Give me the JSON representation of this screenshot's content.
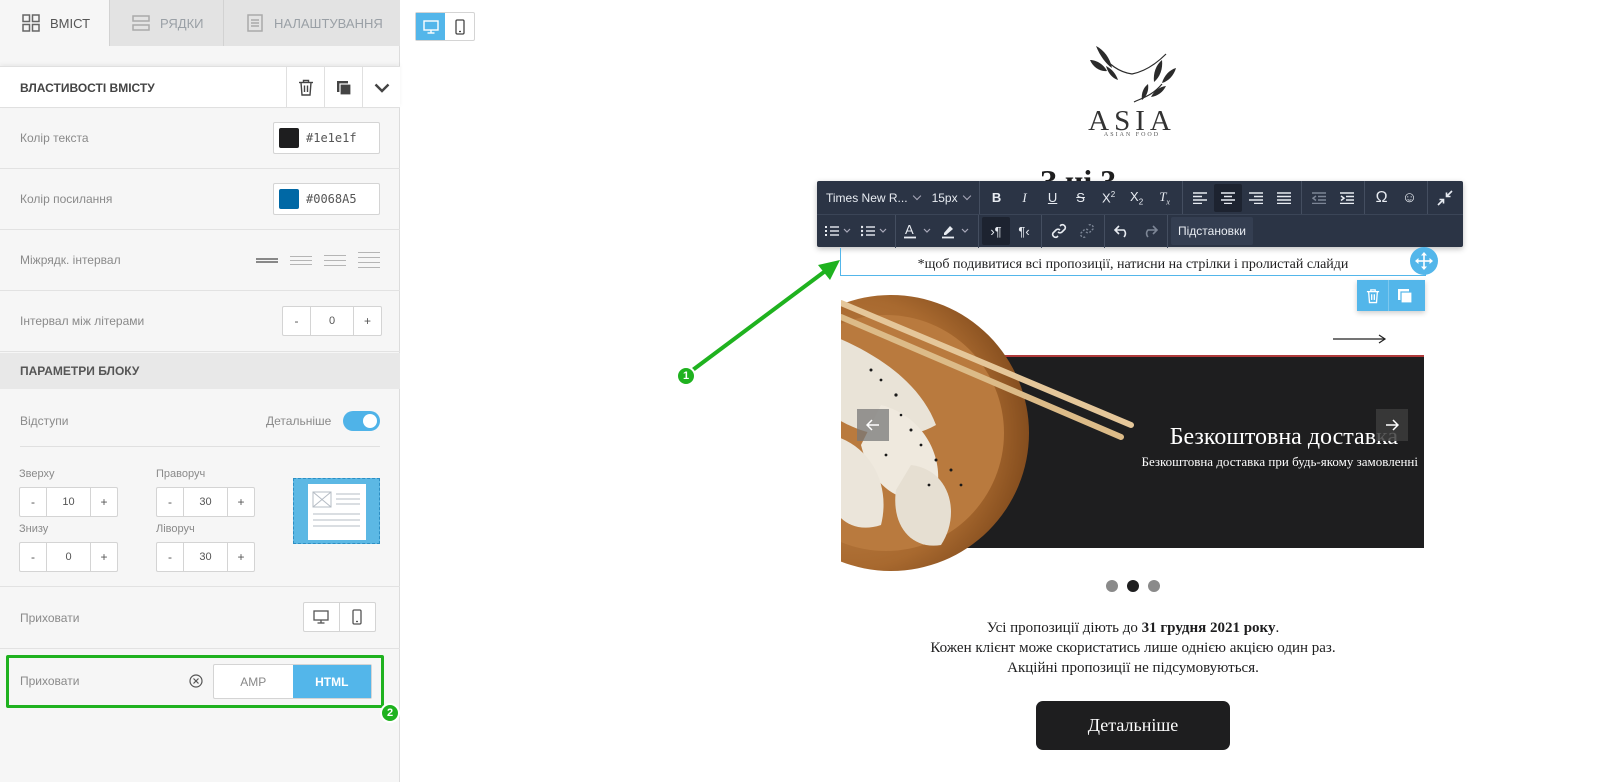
{
  "tabs": [
    {
      "label": "ВМІСТ",
      "icon": "grid-icon",
      "active": true
    },
    {
      "label": "РЯДКИ",
      "icon": "rows-icon",
      "active": false
    },
    {
      "label": "НАЛАШТУВАННЯ",
      "icon": "settings-doc-icon",
      "active": false
    }
  ],
  "properties": {
    "title": "ВЛАСТИВОСТІ ВМІСТУ",
    "text_color": {
      "label": "Колір текста",
      "value": "#1e1e1f",
      "swatch": "#1e1e1f"
    },
    "link_color": {
      "label": "Колір посилання",
      "value": "#0068A5",
      "swatch": "#0068a5"
    },
    "line_spacing": {
      "label": "Міжрядк. інтервал"
    },
    "letter_spacing": {
      "label": "Інтервал між літерами",
      "value": "0",
      "minus": "-",
      "plus": "+"
    }
  },
  "block_params": {
    "title": "ПАРАМЕТРИ БЛОКУ",
    "padding": {
      "label": "Відступи",
      "detail_label": "Детальніше",
      "detail_enabled": true
    },
    "top": {
      "label": "Зверху",
      "value": "10"
    },
    "right": {
      "label": "Праворуч",
      "value": "30"
    },
    "bottom": {
      "label": "Знизу",
      "value": "0"
    },
    "left": {
      "label": "Ліворуч",
      "value": "30"
    },
    "minus": "-",
    "plus": "+",
    "hide_device": {
      "label": "Приховати"
    },
    "hide_format": {
      "label": "Приховати",
      "amp": "AMP",
      "html": "HTML",
      "selected": "HTML"
    }
  },
  "callouts": {
    "one": "1",
    "two": "2"
  },
  "canvas": {
    "logo": {
      "name": "ASIA",
      "tagline": "ASIAN FOOD"
    },
    "hidden_heading": "З        ці 3",
    "toolbar": {
      "font": "Times New R...",
      "size": "15px",
      "substitutions": "Підстановки"
    },
    "edited_text": "*щоб подивитися всі пропозиції, натисни на стрілки і пролистай слайди",
    "slide": {
      "title": "Безкоштовна доставка",
      "subtitle": "Безкоштовна доставка при будь-якому замовленні"
    },
    "terms": {
      "line1_pre": "Усі пропозиції діють до ",
      "line1_bold": "31 грудня 2021 року",
      "line1_post": ".",
      "line2": "Кожен клієнт може скористатись лише однією акцією один раз.",
      "line3": "Акційні пропозиції не підсумовуються."
    },
    "cta": "Детальніше"
  },
  "colors": {
    "accent": "#53b6ea",
    "callout": "#1fb21f",
    "dark": "#1e1e1f",
    "toolbar": "#2b3445"
  }
}
